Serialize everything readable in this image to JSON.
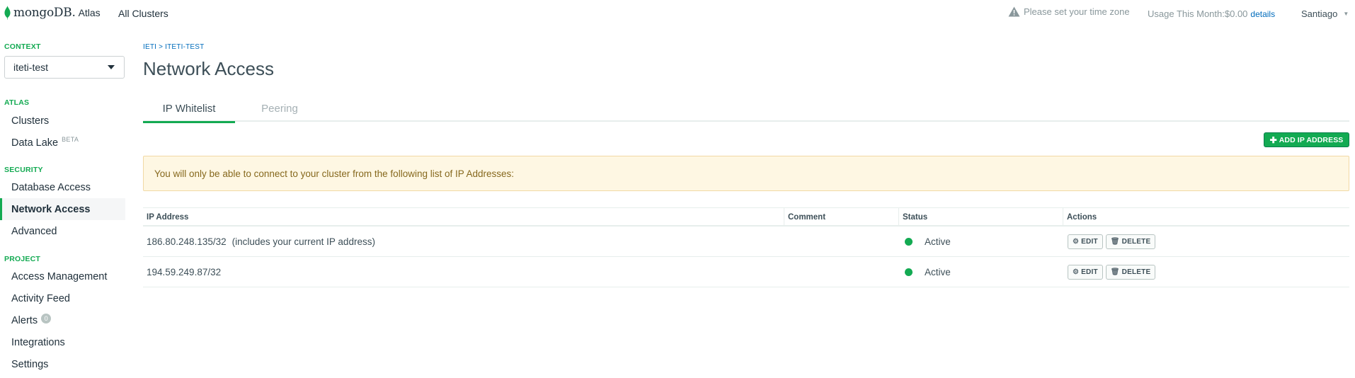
{
  "topbar": {
    "brand": "mongoDB.",
    "product": "Atlas",
    "all_clusters": "All Clusters",
    "timezone_warning": "Please set your time zone",
    "usage_label": "Usage This Month:$0.00",
    "usage_details": "details",
    "user": "Santiago"
  },
  "sidebar": {
    "context_label": "CONTEXT",
    "context_value": "iteti-test",
    "atlas_label": "ATLAS",
    "atlas_items": [
      {
        "label": "Clusters"
      },
      {
        "label": "Data Lake",
        "badge": "BETA"
      }
    ],
    "security_label": "SECURITY",
    "security_items": [
      {
        "label": "Database Access"
      },
      {
        "label": "Network Access"
      },
      {
        "label": "Advanced"
      }
    ],
    "project_label": "PROJECT",
    "project_items": [
      {
        "label": "Access Management"
      },
      {
        "label": "Activity Feed"
      },
      {
        "label": "Alerts",
        "count": "0"
      },
      {
        "label": "Integrations"
      },
      {
        "label": "Settings"
      }
    ]
  },
  "main": {
    "breadcrumb": "IETI > ITETI-TEST",
    "title": "Network Access",
    "tabs": [
      {
        "label": "IP Whitelist"
      },
      {
        "label": "Peering"
      }
    ],
    "add_button": "ADD IP ADDRESS",
    "notice": "You will only be able to connect to your cluster from the following list of IP Addresses:",
    "table": {
      "headers": [
        "IP Address",
        "Comment",
        "Status",
        "Actions"
      ],
      "rows": [
        {
          "ip": "186.80.248.135/32",
          "note": "(includes your current IP address)",
          "comment": "",
          "status": "Active",
          "edit": "EDIT",
          "delete": "DELETE"
        },
        {
          "ip": "194.59.249.87/32",
          "note": "",
          "comment": "",
          "status": "Active",
          "edit": "EDIT",
          "delete": "DELETE"
        }
      ]
    }
  },
  "colors": {
    "accent": "#13aa52",
    "link": "#006cbc",
    "notice_bg": "#fef7e3",
    "notice_text": "#86681d"
  }
}
